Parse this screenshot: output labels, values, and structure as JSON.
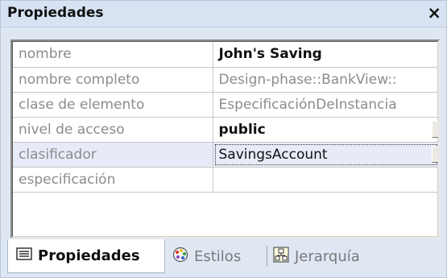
{
  "window": {
    "title": "Propiedades",
    "close_label": "×"
  },
  "properties": [
    {
      "key": "nombre",
      "value": "John's Saving",
      "style": "bold"
    },
    {
      "key": "nombre completo",
      "value": "Design-phase::BankView::",
      "style": "muted"
    },
    {
      "key": "clase de elemento",
      "value": "EspecificaciónDeInstancia",
      "style": "muted"
    },
    {
      "key": "nivel de acceso",
      "value": "public",
      "style": "bold",
      "dropdown": true
    },
    {
      "key": "clasificador",
      "value": "SavingsAccount",
      "style": "normal",
      "dropdown": true,
      "selected": true
    },
    {
      "key": "especificación",
      "value": "",
      "style": "normal"
    }
  ],
  "tabs": [
    {
      "label": "Propiedades",
      "icon": "properties-icon",
      "active": true
    },
    {
      "label": "Estilos",
      "icon": "palette-icon",
      "active": false
    },
    {
      "label": "Jerarquía",
      "icon": "hierarchy-icon",
      "active": false
    }
  ],
  "colors": {
    "titlebar": "#d7e3f3",
    "selected_row": "#e7ebf8",
    "muted_text": "#8c8c8c"
  }
}
